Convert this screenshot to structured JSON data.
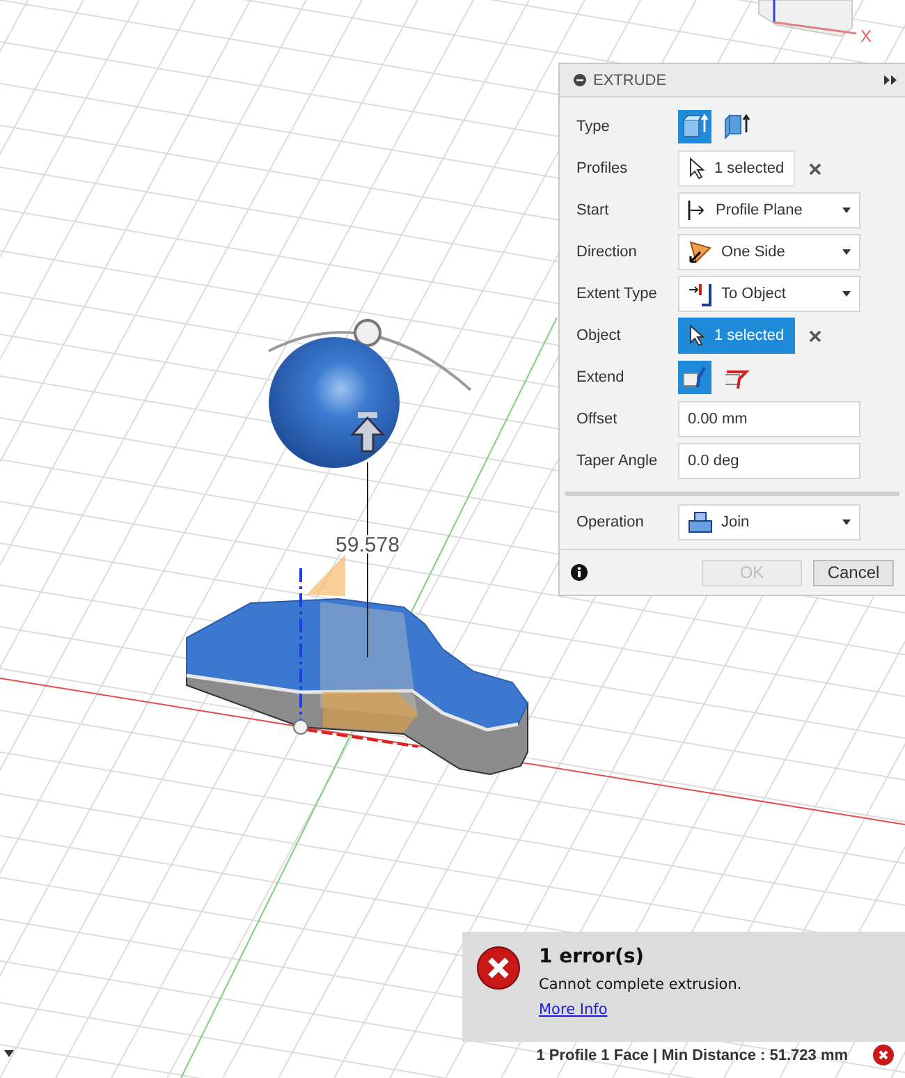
{
  "viewport": {
    "dimension": "59.578",
    "view_cube": {
      "axis_label": "X"
    }
  },
  "extrude_panel": {
    "title": "EXTRUDE",
    "rows": [
      {
        "kind": "toggle",
        "label": "Type",
        "options": [
          {
            "selected": true
          },
          {
            "selected": false
          }
        ]
      },
      {
        "kind": "selection",
        "label": "Profiles",
        "value": "1 selected",
        "active": false
      },
      {
        "kind": "dropdown",
        "label": "Start",
        "value": "Profile Plane"
      },
      {
        "kind": "dropdown",
        "label": "Direction",
        "value": "One Side"
      },
      {
        "kind": "dropdown",
        "label": "Extent Type",
        "value": "To Object"
      },
      {
        "kind": "selection",
        "label": "Object",
        "value": "1 selected",
        "active": true
      },
      {
        "kind": "toggle",
        "label": "Extend",
        "options": [
          {
            "selected": true
          },
          {
            "selected": false
          }
        ]
      },
      {
        "kind": "input",
        "label": "Offset",
        "value": "0.00 mm"
      },
      {
        "kind": "input",
        "label": "Taper Angle",
        "value": "0.0 deg"
      }
    ],
    "operation": {
      "label": "Operation",
      "value": "Join"
    },
    "buttons": [
      {
        "label": "OK",
        "disabled": true
      },
      {
        "label": "Cancel",
        "disabled": false
      }
    ]
  },
  "error": {
    "title": "1 error(s)",
    "message": "Cannot complete extrusion.",
    "link": "More Info"
  },
  "status_bar": {
    "text": "1 Profile 1 Face | Min Distance : 51.723 mm"
  }
}
